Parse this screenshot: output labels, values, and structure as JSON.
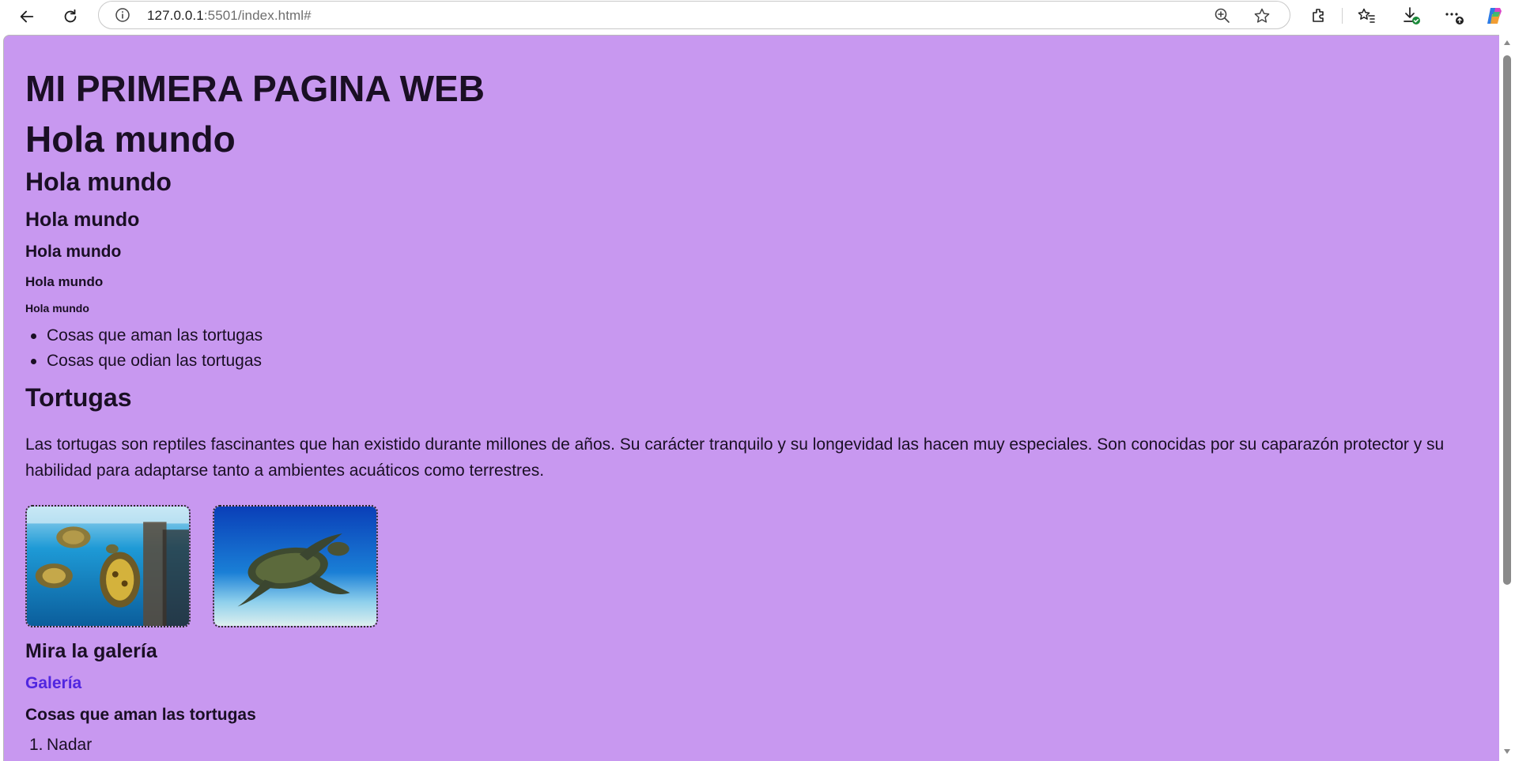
{
  "browser": {
    "url_host": "127.0.0.1",
    "url_rest": ":5501/index.html#",
    "icons": [
      "back-arrow-icon",
      "reload-icon",
      "site-info-icon",
      "zoom-icon",
      "favorite-star-icon",
      "extensions-icon",
      "favorites-icon",
      "downloads-icon",
      "more-menu-icon",
      "copilot-icon"
    ]
  },
  "page": {
    "background_color": "#c898f0",
    "main_title": "MI PRIMERA PAGINA WEB",
    "headings": {
      "h1": "Hola mundo",
      "h2": "Hola mundo",
      "h3": "Hola mundo",
      "h4": "Hola mundo",
      "h5": "Hola mundo",
      "h6": "Hola mundo"
    },
    "bullet_list": [
      "Cosas que aman las tortugas",
      "Cosas que odian las tortugas"
    ],
    "section_title": "Tortugas",
    "paragraph": "Las tortugas son reptiles fascinantes que han existido durante millones de años. Su carácter tranquilo y su longevidad las hacen muy especiales. Son conocidas por su caparazón protector y su habilidad para adaptarse tanto a ambientes acuáticos como terrestres.",
    "gallery_heading": "Mira la galería",
    "gallery_link": "Galería",
    "link_color": "#5126e0",
    "love_heading": "Cosas que aman las tortugas",
    "ordered_list": [
      {
        "num": "1.",
        "text": "Nadar"
      }
    ]
  }
}
